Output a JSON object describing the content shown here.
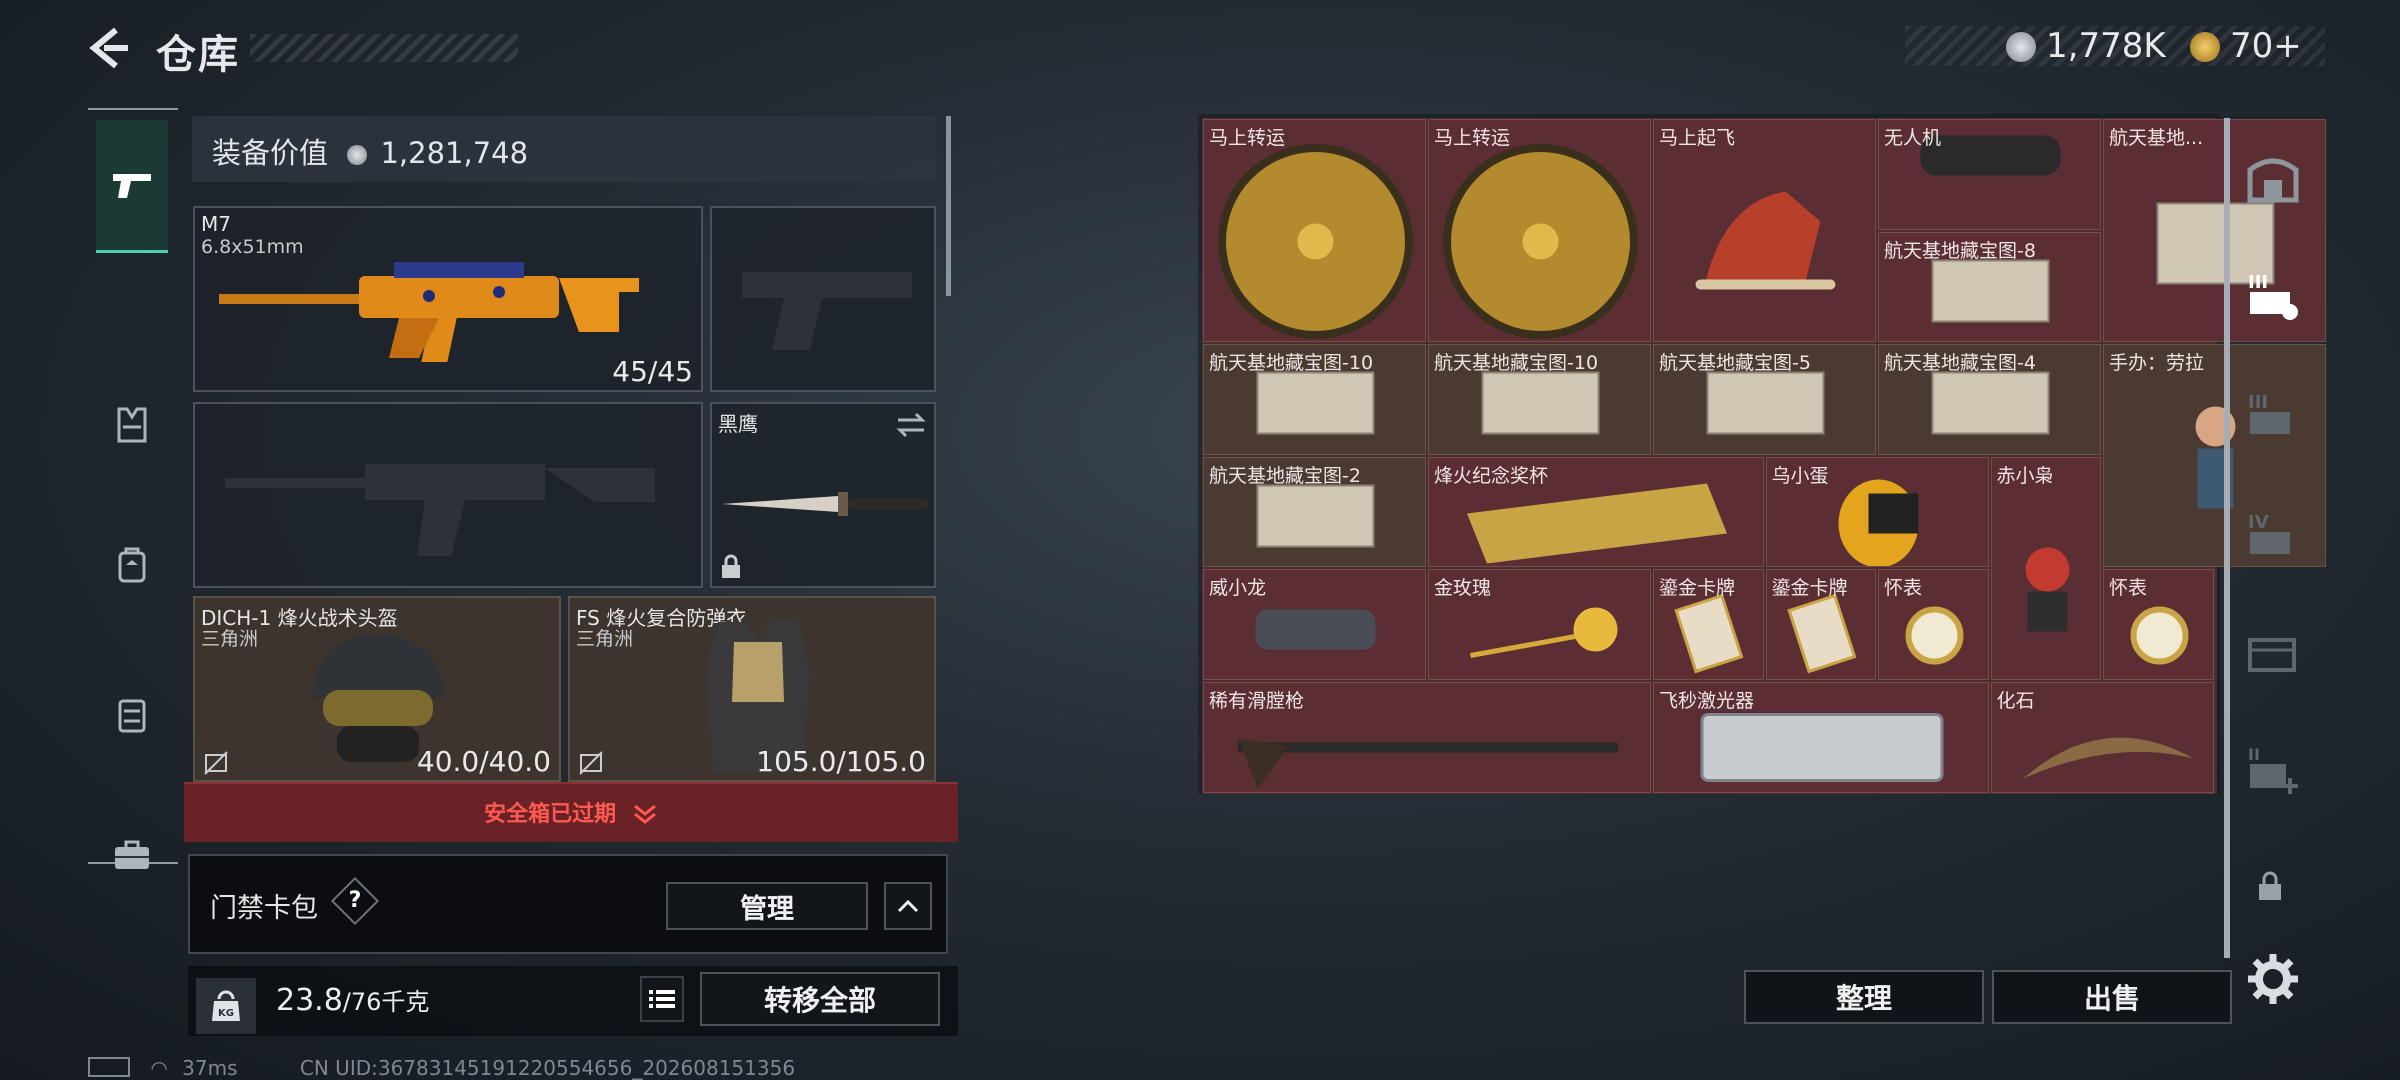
{
  "header": {
    "title": "仓库",
    "currency": {
      "silver_value": "1,778K",
      "gold_value": "70+",
      "silver_color": "#cfd3d6",
      "gold_color": "#e2b13c"
    }
  },
  "left_nav": {
    "items": [
      {
        "name": "weapons",
        "icon": "pistol-icon",
        "active": true
      },
      {
        "name": "armor",
        "icon": "vest-icon",
        "active": false
      },
      {
        "name": "backpack",
        "icon": "backpack-icon",
        "active": false
      },
      {
        "name": "rig",
        "icon": "chest-rig-icon",
        "active": false
      },
      {
        "name": "case",
        "icon": "briefcase-icon",
        "active": false
      }
    ]
  },
  "loadout": {
    "equip_value_label": "装备价值",
    "equip_value": "1,281,748",
    "primary": {
      "name": "M7",
      "ammo": "6.8x51mm",
      "count": "45/45"
    },
    "melee": {
      "name": "黑鹰"
    },
    "helmet": {
      "name": "DICH-1 烽火战术头盔",
      "sub": "三角洲",
      "durability": "40.0/40.0"
    },
    "armor": {
      "name": "FS 烽火复合防弹衣",
      "sub": "三角洲",
      "durability": "105.0/105.0"
    },
    "safe_box_expired": "安全箱已过期",
    "keycard_label": "门禁卡包",
    "help": "?",
    "manage": "管理",
    "weight_current": "23.8",
    "weight_max": "/76千克",
    "transfer_all": "转移全部",
    "kg_badge": "KG"
  },
  "storage": {
    "items": [
      {
        "name": "马上转运",
        "type": "coin",
        "color": "red"
      },
      {
        "name": "马上转运",
        "type": "coin",
        "color": "red"
      },
      {
        "name": "马上起飞",
        "type": "horse",
        "color": "red"
      },
      {
        "name": "无人机",
        "type": "drone",
        "color": "red"
      },
      {
        "name": "航天基地...",
        "type": "map",
        "color": "red"
      },
      {
        "name": "航天基地藏宝图-8",
        "type": "map",
        "color": "red"
      },
      {
        "name": "航天基地藏宝图-10",
        "type": "map",
        "color": "brown"
      },
      {
        "name": "航天基地藏宝图-10",
        "type": "map",
        "color": "brown"
      },
      {
        "name": "航天基地藏宝图-5",
        "type": "map",
        "color": "brown"
      },
      {
        "name": "航天基地藏宝图-4",
        "type": "map",
        "color": "brown"
      },
      {
        "name": "手办：劳拉",
        "type": "figure",
        "color": "brown"
      },
      {
        "name": "航天基地藏宝图-2",
        "type": "map",
        "color": "brown"
      },
      {
        "name": "烽火纪念奖杯",
        "type": "trophy",
        "color": "red"
      },
      {
        "name": "乌小蛋",
        "type": "egg",
        "color": "red"
      },
      {
        "name": "赤小枭",
        "type": "figure2",
        "color": "red"
      },
      {
        "name": "威小龙",
        "type": "dragon",
        "color": "red"
      },
      {
        "name": "金玫瑰",
        "type": "rose",
        "color": "red"
      },
      {
        "name": "鎏金卡牌",
        "type": "card",
        "color": "red"
      },
      {
        "name": "鎏金卡牌",
        "type": "card",
        "color": "red"
      },
      {
        "name": "怀表",
        "type": "watch",
        "color": "red"
      },
      {
        "name": "怀表",
        "type": "watch",
        "color": "red"
      },
      {
        "name": "稀有滑膛枪",
        "type": "musket",
        "color": "red"
      },
      {
        "name": "飞秒激光器",
        "type": "laser",
        "color": "red"
      },
      {
        "name": "化石",
        "type": "fossil",
        "color": "red"
      }
    ],
    "sort_label": "整理",
    "sell_label": "出售"
  },
  "right_nav": {
    "icons": [
      "stash-icon",
      "tab-III-icon",
      "tab-III-locked-icon",
      "tab-IV-icon",
      "tab-add-icon",
      "tab-add-plus-icon",
      "lock-icon",
      "gear-icon"
    ]
  },
  "status": {
    "ping": "37ms",
    "uid": "CN UID:3678314519122055465​6_202608151356"
  }
}
